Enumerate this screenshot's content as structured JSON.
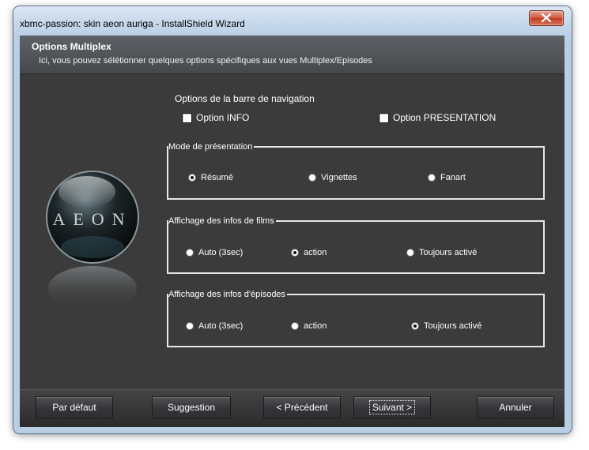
{
  "window": {
    "title": "xbmc-passion:  skin aeon auriga - InstallShield Wizard"
  },
  "header": {
    "title": "Options Multiplex",
    "subtitle": "Ici, vous pouvez sélétionner quelques options spécifiques aux vues Multiplex/Episodes"
  },
  "navbar": {
    "label": "Options de la barre de navigation",
    "option_info": {
      "label": "Option INFO",
      "checked": false
    },
    "option_presentation": {
      "label": "Option PRESENTATION",
      "checked": false
    }
  },
  "groups": [
    {
      "legend": "Mode de présentation",
      "options": [
        "Résumé",
        "Vignettes",
        "Fanart"
      ],
      "selected": 0
    },
    {
      "legend": "Affichage des infos de films",
      "options": [
        "Auto (3sec)",
        "action",
        "Toujours activé"
      ],
      "selected": 1
    },
    {
      "legend": "Affichage des infos d'épisodes",
      "options": [
        "Auto (3sec)",
        "action",
        "Toujours activé"
      ],
      "selected": 2
    }
  ],
  "logo": {
    "text": "AEON"
  },
  "buttons": {
    "default": "Par défaut",
    "suggestion": "Suggestion",
    "previous": "< Précédent",
    "next": "Suivant >",
    "cancel": "Annuler"
  },
  "colors": {
    "background": "#3b3b3b",
    "header": "#56585c",
    "text": "#ffffff",
    "close": "#c9422a"
  }
}
